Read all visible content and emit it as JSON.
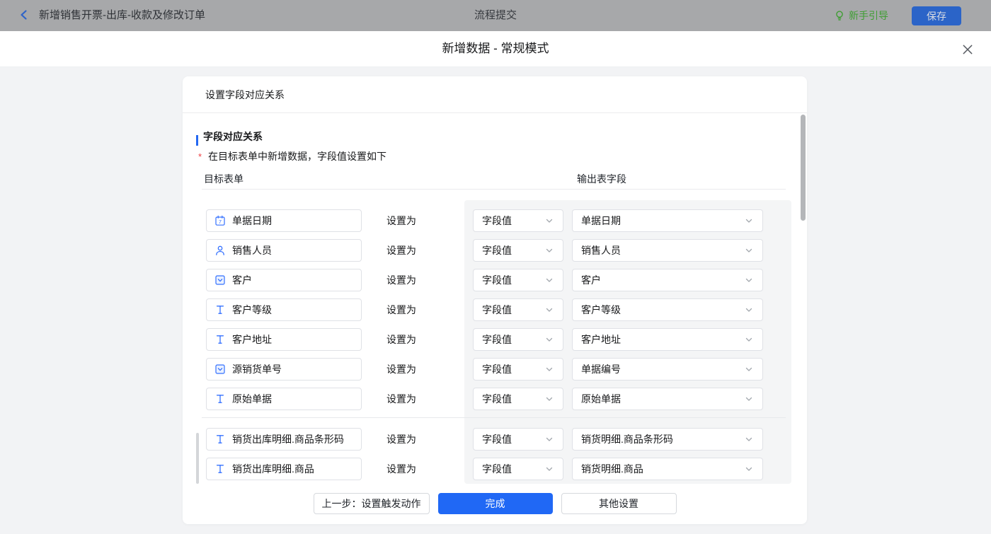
{
  "topbar": {
    "back_title": "新增销售开票-出库-收款及修改订单",
    "center_title": "流程提交",
    "guide_label": "新手引导",
    "save_label": "保存"
  },
  "modal": {
    "title": "新增数据 - 常规模式"
  },
  "panel": {
    "header": "设置字段对应关系",
    "section_title": "字段对应关系",
    "required_mark": "*",
    "description": "在目标表单中新增数据，字段值设置如下",
    "col_target": "目标表单",
    "col_output": "输出表字段",
    "set_as_label": "设置为",
    "groups": [
      {
        "rows": [
          {
            "icon": "calendar-icon",
            "target": "单据日期",
            "setter": "字段值",
            "output": "单据日期"
          },
          {
            "icon": "user-icon",
            "target": "销售人员",
            "setter": "字段值",
            "output": "销售人员"
          },
          {
            "icon": "select-icon",
            "target": "客户",
            "setter": "字段值",
            "output": "客户"
          },
          {
            "icon": "text-icon",
            "target": "客户等级",
            "setter": "字段值",
            "output": "客户等级"
          },
          {
            "icon": "text-icon",
            "target": "客户地址",
            "setter": "字段值",
            "output": "客户地址"
          },
          {
            "icon": "select-icon",
            "target": "源销货单号",
            "setter": "字段值",
            "output": "单据编号"
          },
          {
            "icon": "text-icon",
            "target": "原始单据",
            "setter": "字段值",
            "output": "原始单据"
          }
        ]
      },
      {
        "rows": [
          {
            "icon": "text-icon",
            "target": "销货出库明细.商品条形码",
            "setter": "字段值",
            "output": "销货明细.商品条形码"
          },
          {
            "icon": "text-icon",
            "target": "销货出库明细.商品",
            "setter": "字段值",
            "output": "销货明细.商品"
          }
        ]
      }
    ]
  },
  "footer": {
    "prev_label": "上一步：设置触发动作",
    "done_label": "完成",
    "other_label": "其他设置"
  },
  "colors": {
    "accent_blue": "#2068f5",
    "icon_blue": "#3370ff",
    "guide_green": "#3f9e33",
    "topbar_dim": "#a7a8aa",
    "page_bg": "#f2f3f5",
    "required_red": "#ef4044"
  }
}
